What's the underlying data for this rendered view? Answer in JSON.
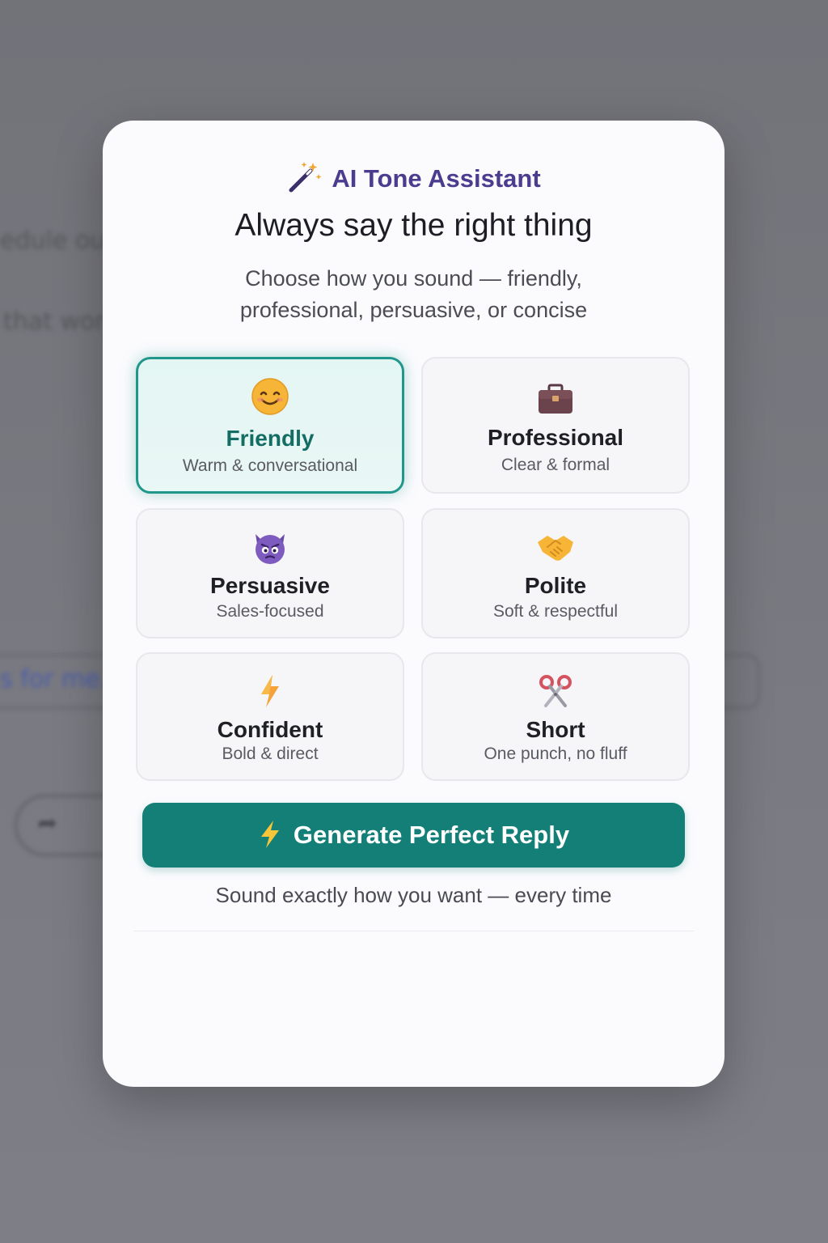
{
  "background": {
    "text_1": "edule our",
    "text_2": "that wor",
    "text_3": "s for me."
  },
  "modal": {
    "brand_icon": "magic-wand-icon",
    "brand_name": "AI Tone Assistant",
    "headline": "Always say the right thing",
    "subtitle": "Choose how you sound — friendly, professional, persuasive, or concise",
    "tones": [
      {
        "icon": "smiling-face-icon",
        "title": "Friendly",
        "desc": "Warm & conversational",
        "selected": true
      },
      {
        "icon": "briefcase-icon",
        "title": "Professional",
        "desc": "Clear & formal",
        "selected": false
      },
      {
        "icon": "devil-face-icon",
        "title": "Persuasive",
        "desc": "Sales-focused",
        "selected": false
      },
      {
        "icon": "handshake-icon",
        "title": "Polite",
        "desc": "Soft & respectful",
        "selected": false
      },
      {
        "icon": "lightning-icon",
        "title": "Confident",
        "desc": "Bold & direct",
        "selected": false
      },
      {
        "icon": "scissors-icon",
        "title": "Short",
        "desc": "One punch, no fluff",
        "selected": false
      }
    ],
    "generate_button": {
      "icon": "lightning-icon",
      "label": "Generate Perfect Reply"
    },
    "tagline": "Sound exactly how you want — every time"
  },
  "colors": {
    "accent": "#137f77",
    "selected_border": "#21968a",
    "brand": "#4b3c8f"
  }
}
